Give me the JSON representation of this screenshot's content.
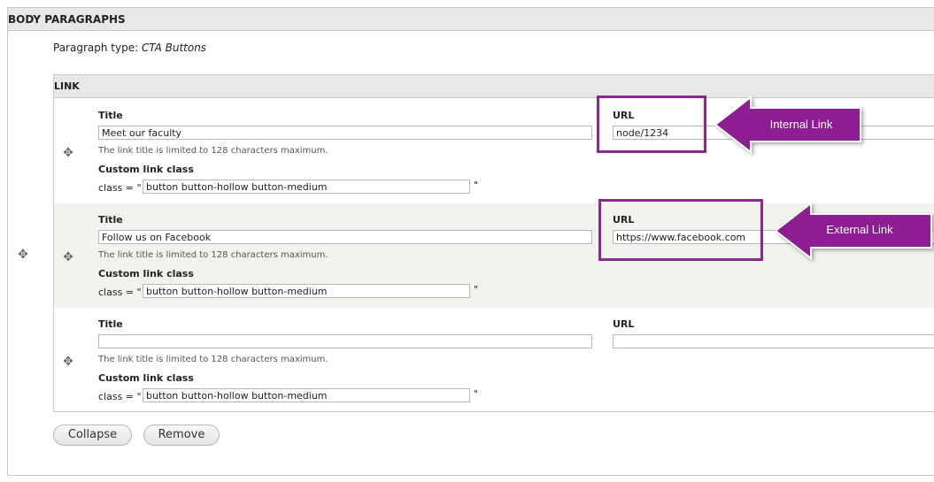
{
  "section_title": "BODY PARAGRAPHS",
  "paragraph_type": {
    "label": "Paragraph type:",
    "value": "CTA Buttons"
  },
  "table_title": "LINK",
  "field_labels": {
    "title": "Title",
    "url": "URL",
    "custom_class": "Custom link class",
    "class_prefix": "class = \"",
    "class_suffix": "\""
  },
  "title_description": "The link title is limited to 128 characters maximum.",
  "rows": [
    {
      "title": "Meet our faculty",
      "url": "node/1234",
      "class": "button button-hollow button-medium"
    },
    {
      "title": "Follow us on Facebook",
      "url": "https://www.facebook.com",
      "class": "button button-hollow button-medium"
    },
    {
      "title": "",
      "url": "",
      "class": "button button-hollow button-medium"
    }
  ],
  "buttons": {
    "collapse": "Collapse",
    "remove": "Remove"
  },
  "annotations": {
    "internal": "Internal Link",
    "external": "External Link"
  },
  "colors": {
    "highlight": "#8a2a8e",
    "arrow": "#8e1c92"
  },
  "icons": {
    "drag": "move-icon"
  }
}
